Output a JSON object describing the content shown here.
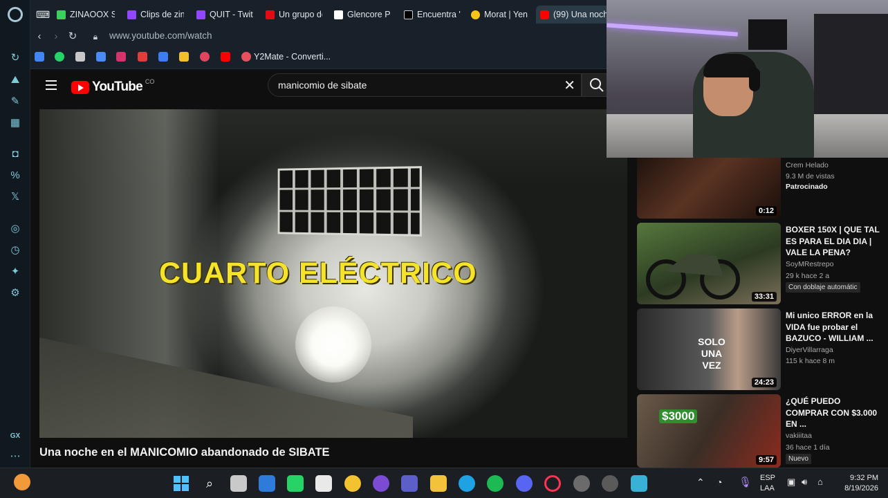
{
  "browser": {
    "tabs": [
      {
        "label": "ZINAOOX St",
        "color": "#3ad05b"
      },
      {
        "label": "Clips de zin",
        "color": "#9146ff"
      },
      {
        "label": "QUIT - Twit",
        "color": "#9146ff"
      },
      {
        "label": "Un grupo de",
        "color": "#e50914"
      },
      {
        "label": "Glencore Pe",
        "color": "#ffffff"
      },
      {
        "label": "Encuentra \"",
        "color": "#000000"
      },
      {
        "label": "Morat | Yen",
        "color": "#f5c518"
      },
      {
        "label": "(99) Una noch",
        "color": "#ff0000"
      }
    ],
    "url": "www.youtube.com/watch",
    "bookmark_label": "Y2Mate - Converti..."
  },
  "youtube": {
    "logo_text": "YouTube",
    "country_code": "CO",
    "search_query": "manicomio de sibate",
    "video_overlay_text": "CUARTO ELÉCTRICO",
    "video_title": "Una noche en el MANICOMIO abandonado de SIBATE"
  },
  "recommendations": [
    {
      "title": "",
      "channel": "Crem Helado",
      "views": "9.3 M de vistas",
      "badge": "Patrocinado",
      "duration": "0:12",
      "thumb_color": "#2b1a14"
    },
    {
      "title": "BOXER 150X | QUE TAL ES PARA EL DIA DIA | VALE LA PENA?",
      "channel": "SoyMRestrepo",
      "views": "29 k  hace 2 a",
      "badge": "Con doblaje automátic",
      "duration": "33:31",
      "thumb_color": "#3e5a2c"
    },
    {
      "title": "Mi unico ERROR en la VIDA fue probar el BAZUCO - WILLIAM ...",
      "channel": "DiyerVillarraga",
      "views": "115 k  hace 8 m",
      "badge": "",
      "duration": "24:23",
      "thumb_color": "#4a4a4a",
      "thumb_text": "SOLO UNA VEZ"
    },
    {
      "title": "¿QUÉ PUEDO COMPRAR CON $3.000 EN ...",
      "channel": "vakiiitaa",
      "views": "36  hace 1 día",
      "badge": "Nuevo",
      "duration": "9:57",
      "thumb_color": "#5c4a3a",
      "thumb_text": "$3000"
    }
  ],
  "taskbar": {
    "language": "ESP",
    "layout": "LAA",
    "time": "9:32 PM",
    "date": "8/19/2026"
  }
}
